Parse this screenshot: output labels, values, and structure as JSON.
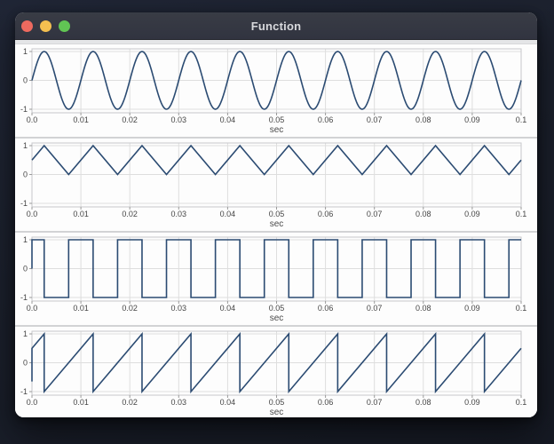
{
  "window": {
    "title": "Function",
    "buttons": [
      {
        "name": "close-button",
        "color": "#ee6a5f"
      },
      {
        "name": "minimize-button",
        "color": "#f4bf50"
      },
      {
        "name": "zoom-button",
        "color": "#61c554"
      }
    ],
    "titlebar_color": "#34373f",
    "background_color": "#1b202c"
  },
  "plot_style": {
    "line_color": "#2b4b72",
    "grid_color": "#dedede",
    "frame_color": "#c7c8ca",
    "tick_color": "#9a9a9a",
    "label_color": "#464646",
    "plot_background": "#ffffff"
  },
  "chart_data": [
    {
      "type": "line",
      "wave": "sine",
      "frequency_hz": 100,
      "amplitude": 1,
      "x_range": [
        0,
        0.1
      ],
      "ylim": [
        -1.1,
        1.1
      ],
      "xlabel": "sec",
      "x_ticks": {
        "values": [
          0,
          0.01,
          0.02,
          0.03,
          0.04,
          0.05,
          0.06,
          0.07,
          0.08,
          0.09,
          0.1
        ],
        "labels": [
          "0.0",
          "0.01",
          "0.02",
          "0.03",
          "0.04",
          "0.05",
          "0.06",
          "0.07",
          "0.08",
          "0.09",
          "0.1"
        ]
      },
      "y_ticks": {
        "values": [
          1,
          0,
          -1
        ],
        "labels": [
          "1",
          "0",
          "-1"
        ]
      }
    },
    {
      "type": "line",
      "wave": "triangle",
      "frequency_hz": 100,
      "min": 0,
      "max": 1,
      "x_range": [
        0,
        0.1
      ],
      "ylim": [
        -1.1,
        1.1
      ],
      "xlabel": "sec",
      "x_ticks": {
        "values": [
          0,
          0.01,
          0.02,
          0.03,
          0.04,
          0.05,
          0.06,
          0.07,
          0.08,
          0.09,
          0.1
        ],
        "labels": [
          "0.0",
          "0.01",
          "0.02",
          "0.03",
          "0.04",
          "0.05",
          "0.06",
          "0.07",
          "0.08",
          "0.09",
          "0.1"
        ]
      },
      "y_ticks": {
        "values": [
          1,
          0,
          -1
        ],
        "labels": [
          "1",
          "0",
          "-1"
        ]
      },
      "points": [
        [
          0,
          0.5
        ],
        [
          0.0025,
          1
        ],
        [
          0.0075,
          0
        ],
        [
          0.0125,
          1
        ],
        [
          0.0175,
          0
        ],
        [
          0.0225,
          1
        ],
        [
          0.0275,
          0
        ],
        [
          0.0325,
          1
        ],
        [
          0.0375,
          0
        ],
        [
          0.0425,
          1
        ],
        [
          0.0475,
          0
        ],
        [
          0.0525,
          1
        ],
        [
          0.0575,
          0
        ],
        [
          0.0625,
          1
        ],
        [
          0.0675,
          0
        ],
        [
          0.0725,
          1
        ],
        [
          0.0775,
          0
        ],
        [
          0.0825,
          1
        ],
        [
          0.0875,
          0
        ],
        [
          0.0925,
          1
        ],
        [
          0.0975,
          0
        ],
        [
          0.1,
          0.5
        ]
      ]
    },
    {
      "type": "line",
      "wave": "square",
      "frequency_hz": 100,
      "high": 1,
      "low": -1,
      "x_range": [
        0,
        0.1
      ],
      "ylim": [
        -1.1,
        1.1
      ],
      "xlabel": "sec",
      "x_ticks": {
        "values": [
          0,
          0.01,
          0.02,
          0.03,
          0.04,
          0.05,
          0.06,
          0.07,
          0.08,
          0.09,
          0.1
        ],
        "labels": [
          "0.0",
          "0.01",
          "0.02",
          "0.03",
          "0.04",
          "0.05",
          "0.06",
          "0.07",
          "0.08",
          "0.09",
          "0.1"
        ]
      },
      "y_ticks": {
        "values": [
          1,
          0,
          -1
        ],
        "labels": [
          "1",
          "0",
          "-1"
        ]
      },
      "points": [
        [
          0,
          0
        ],
        [
          0,
          1
        ],
        [
          0.0025,
          1
        ],
        [
          0.0025,
          -1
        ],
        [
          0.0075,
          -1
        ],
        [
          0.0075,
          1
        ],
        [
          0.0125,
          1
        ],
        [
          0.0125,
          -1
        ],
        [
          0.0175,
          -1
        ],
        [
          0.0175,
          1
        ],
        [
          0.0225,
          1
        ],
        [
          0.0225,
          -1
        ],
        [
          0.0275,
          -1
        ],
        [
          0.0275,
          1
        ],
        [
          0.0325,
          1
        ],
        [
          0.0325,
          -1
        ],
        [
          0.0375,
          -1
        ],
        [
          0.0375,
          1
        ],
        [
          0.0425,
          1
        ],
        [
          0.0425,
          -1
        ],
        [
          0.0475,
          -1
        ],
        [
          0.0475,
          1
        ],
        [
          0.0525,
          1
        ],
        [
          0.0525,
          -1
        ],
        [
          0.0575,
          -1
        ],
        [
          0.0575,
          1
        ],
        [
          0.0625,
          1
        ],
        [
          0.0625,
          -1
        ],
        [
          0.0675,
          -1
        ],
        [
          0.0675,
          1
        ],
        [
          0.0725,
          1
        ],
        [
          0.0725,
          -1
        ],
        [
          0.0775,
          -1
        ],
        [
          0.0775,
          1
        ],
        [
          0.0825,
          1
        ],
        [
          0.0825,
          -1
        ],
        [
          0.0875,
          -1
        ],
        [
          0.0875,
          1
        ],
        [
          0.0925,
          1
        ],
        [
          0.0925,
          -1
        ],
        [
          0.0975,
          -1
        ],
        [
          0.0975,
          1
        ],
        [
          0.1,
          1
        ]
      ]
    },
    {
      "type": "line",
      "wave": "sawtooth",
      "frequency_hz": 100,
      "min": -1,
      "max": 1,
      "x_range": [
        0,
        0.1
      ],
      "ylim": [
        -1.1,
        1.1
      ],
      "xlabel": "sec",
      "x_ticks": {
        "values": [
          0,
          0.01,
          0.02,
          0.03,
          0.04,
          0.05,
          0.06,
          0.07,
          0.08,
          0.09,
          0.1
        ],
        "labels": [
          "0.0",
          "0.01",
          "0.02",
          "0.03",
          "0.04",
          "0.05",
          "0.06",
          "0.07",
          "0.08",
          "0.09",
          "0.1"
        ]
      },
      "y_ticks": {
        "values": [
          1,
          0,
          -1
        ],
        "labels": [
          "1",
          "0",
          "-1"
        ]
      },
      "points": [
        [
          0,
          -0.65
        ],
        [
          0,
          0.5
        ],
        [
          0.0025,
          1
        ],
        [
          0.0025,
          -1
        ],
        [
          0.0125,
          1
        ],
        [
          0.0125,
          -1
        ],
        [
          0.0225,
          1
        ],
        [
          0.0225,
          -1
        ],
        [
          0.0325,
          1
        ],
        [
          0.0325,
          -1
        ],
        [
          0.0425,
          1
        ],
        [
          0.0425,
          -1
        ],
        [
          0.0525,
          1
        ],
        [
          0.0525,
          -1
        ],
        [
          0.0625,
          1
        ],
        [
          0.0625,
          -1
        ],
        [
          0.0725,
          1
        ],
        [
          0.0725,
          -1
        ],
        [
          0.0825,
          1
        ],
        [
          0.0825,
          -1
        ],
        [
          0.0925,
          1
        ],
        [
          0.0925,
          -1
        ],
        [
          0.1,
          0.5
        ]
      ]
    }
  ]
}
